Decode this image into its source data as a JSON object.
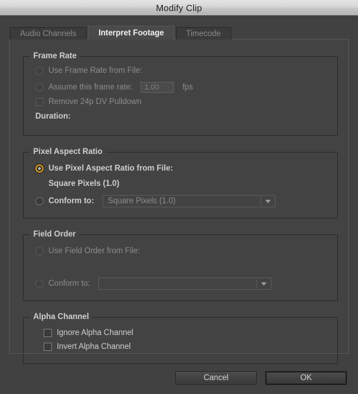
{
  "window": {
    "title": "Modify Clip"
  },
  "tabs": [
    {
      "label": "Audio Channels",
      "active": false
    },
    {
      "label": "Interpret Footage",
      "active": true
    },
    {
      "label": "Timecode",
      "active": false
    }
  ],
  "frame_rate": {
    "title": "Frame Rate",
    "use_from_file_label": "Use Frame Rate from File:",
    "assume_label": "Assume this frame rate:",
    "assume_value": "1.00",
    "fps_label": "fps",
    "pulldown_label": "Remove 24p DV Pulldown",
    "duration_label": "Duration:"
  },
  "pixel_aspect_ratio": {
    "title": "Pixel Aspect Ratio",
    "use_from_file_label": "Use Pixel Aspect Ratio from File:",
    "file_value": "Square Pixels (1.0)",
    "conform_label": "Conform to:",
    "conform_value": "Square Pixels (1.0)"
  },
  "field_order": {
    "title": "Field Order",
    "use_from_file_label": "Use Field Order from File:",
    "conform_label": "Conform to:",
    "conform_value": ""
  },
  "alpha_channel": {
    "title": "Alpha Channel",
    "ignore_label": "Ignore Alpha Channel",
    "invert_label": "Invert Alpha Channel"
  },
  "buttons": {
    "cancel": "Cancel",
    "ok": "OK"
  },
  "colors": {
    "accent": "#d79b28",
    "dialog_bg": "#414141",
    "panel_bg": "#434343"
  }
}
